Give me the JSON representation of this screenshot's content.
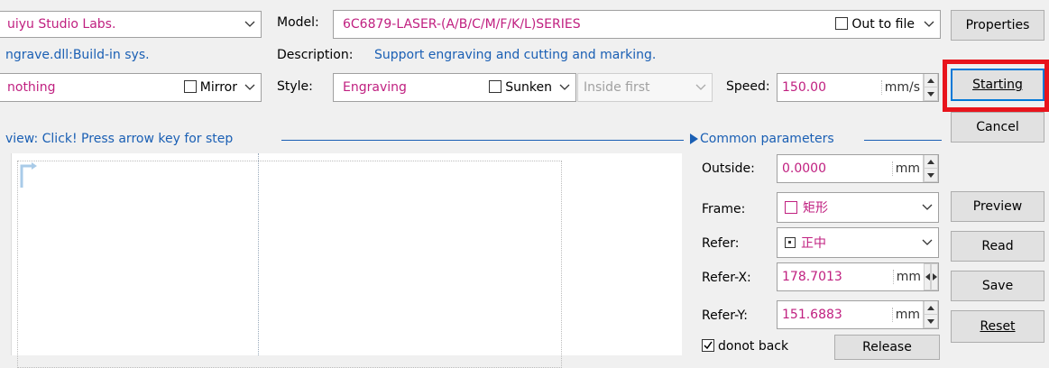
{
  "top": {
    "vendor_value": "uiyu Studio Labs.",
    "model_label": "Model:",
    "model_value": "6C6879-LASER-(A/B/C/M/F/K/L)SERIES",
    "out_to_file_label": "Out to file",
    "driver_text": "ngrave.dll:Build-in sys.",
    "description_label": "Description:",
    "description_value": "Support engraving and cutting and marking.",
    "nothing_value": "nothing",
    "mirror_label": "Mirror",
    "style_label": "Style:",
    "style_value": "Engraving",
    "sunken_label": "Sunken",
    "order_value": "Inside first",
    "speed_label": "Speed:",
    "speed_value": "150.00",
    "speed_unit": "mm/s"
  },
  "buttons": {
    "properties": "Properties",
    "starting": "Starting",
    "cancel": "Cancel",
    "preview": "Preview",
    "read": "Read",
    "save": "Save",
    "reset": "Reset",
    "release": "Release"
  },
  "preview": {
    "title": "view: Click! Press arrow key for step"
  },
  "common": {
    "title": "Common parameters",
    "outside_label": "Outside:",
    "outside_value": "0.0000",
    "outside_unit": "mm",
    "frame_label": "Frame:",
    "frame_value": "矩形",
    "refer_label": "Refer:",
    "refer_value": "正中",
    "referx_label": "Refer-X:",
    "referx_value": "178.7013",
    "referx_unit": "mm",
    "refery_label": "Refer-Y:",
    "refery_value": "151.6883",
    "refery_unit": "mm",
    "donot_back_label": "donot back",
    "donot_back_checked": true
  },
  "colors": {
    "value_text": "#c02080",
    "link_text": "#1a5fb4",
    "highlight_box": "#e8141c"
  }
}
